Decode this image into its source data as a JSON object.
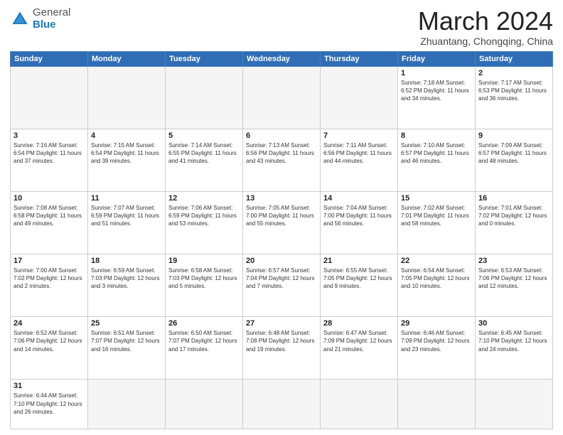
{
  "header": {
    "logo_general": "General",
    "logo_blue": "Blue",
    "month_title": "March 2024",
    "subtitle": "Zhuantang, Chongqing, China"
  },
  "weekdays": [
    "Sunday",
    "Monday",
    "Tuesday",
    "Wednesday",
    "Thursday",
    "Friday",
    "Saturday"
  ],
  "weeks": [
    [
      {
        "day": "",
        "info": ""
      },
      {
        "day": "",
        "info": ""
      },
      {
        "day": "",
        "info": ""
      },
      {
        "day": "",
        "info": ""
      },
      {
        "day": "",
        "info": ""
      },
      {
        "day": "1",
        "info": "Sunrise: 7:18 AM\nSunset: 6:52 PM\nDaylight: 11 hours\nand 34 minutes."
      },
      {
        "day": "2",
        "info": "Sunrise: 7:17 AM\nSunset: 6:53 PM\nDaylight: 11 hours\nand 36 minutes."
      }
    ],
    [
      {
        "day": "3",
        "info": "Sunrise: 7:16 AM\nSunset: 6:54 PM\nDaylight: 11 hours\nand 37 minutes."
      },
      {
        "day": "4",
        "info": "Sunrise: 7:15 AM\nSunset: 6:54 PM\nDaylight: 11 hours\nand 39 minutes."
      },
      {
        "day": "5",
        "info": "Sunrise: 7:14 AM\nSunset: 6:55 PM\nDaylight: 11 hours\nand 41 minutes."
      },
      {
        "day": "6",
        "info": "Sunrise: 7:13 AM\nSunset: 6:56 PM\nDaylight: 11 hours\nand 43 minutes."
      },
      {
        "day": "7",
        "info": "Sunrise: 7:11 AM\nSunset: 6:56 PM\nDaylight: 11 hours\nand 44 minutes."
      },
      {
        "day": "8",
        "info": "Sunrise: 7:10 AM\nSunset: 6:57 PM\nDaylight: 11 hours\nand 46 minutes."
      },
      {
        "day": "9",
        "info": "Sunrise: 7:09 AM\nSunset: 6:57 PM\nDaylight: 11 hours\nand 48 minutes."
      }
    ],
    [
      {
        "day": "10",
        "info": "Sunrise: 7:08 AM\nSunset: 6:58 PM\nDaylight: 11 hours\nand 49 minutes."
      },
      {
        "day": "11",
        "info": "Sunrise: 7:07 AM\nSunset: 6:59 PM\nDaylight: 11 hours\nand 51 minutes."
      },
      {
        "day": "12",
        "info": "Sunrise: 7:06 AM\nSunset: 6:59 PM\nDaylight: 11 hours\nand 53 minutes."
      },
      {
        "day": "13",
        "info": "Sunrise: 7:05 AM\nSunset: 7:00 PM\nDaylight: 11 hours\nand 55 minutes."
      },
      {
        "day": "14",
        "info": "Sunrise: 7:04 AM\nSunset: 7:00 PM\nDaylight: 11 hours\nand 56 minutes."
      },
      {
        "day": "15",
        "info": "Sunrise: 7:02 AM\nSunset: 7:01 PM\nDaylight: 11 hours\nand 58 minutes."
      },
      {
        "day": "16",
        "info": "Sunrise: 7:01 AM\nSunset: 7:02 PM\nDaylight: 12 hours\nand 0 minutes."
      }
    ],
    [
      {
        "day": "17",
        "info": "Sunrise: 7:00 AM\nSunset: 7:02 PM\nDaylight: 12 hours\nand 2 minutes."
      },
      {
        "day": "18",
        "info": "Sunrise: 6:59 AM\nSunset: 7:03 PM\nDaylight: 12 hours\nand 3 minutes."
      },
      {
        "day": "19",
        "info": "Sunrise: 6:58 AM\nSunset: 7:03 PM\nDaylight: 12 hours\nand 5 minutes."
      },
      {
        "day": "20",
        "info": "Sunrise: 6:57 AM\nSunset: 7:04 PM\nDaylight: 12 hours\nand 7 minutes."
      },
      {
        "day": "21",
        "info": "Sunrise: 6:55 AM\nSunset: 7:05 PM\nDaylight: 12 hours\nand 9 minutes."
      },
      {
        "day": "22",
        "info": "Sunrise: 6:54 AM\nSunset: 7:05 PM\nDaylight: 12 hours\nand 10 minutes."
      },
      {
        "day": "23",
        "info": "Sunrise: 6:53 AM\nSunset: 7:06 PM\nDaylight: 12 hours\nand 12 minutes."
      }
    ],
    [
      {
        "day": "24",
        "info": "Sunrise: 6:52 AM\nSunset: 7:06 PM\nDaylight: 12 hours\nand 14 minutes."
      },
      {
        "day": "25",
        "info": "Sunrise: 6:51 AM\nSunset: 7:07 PM\nDaylight: 12 hours\nand 16 minutes."
      },
      {
        "day": "26",
        "info": "Sunrise: 6:50 AM\nSunset: 7:07 PM\nDaylight: 12 hours\nand 17 minutes."
      },
      {
        "day": "27",
        "info": "Sunrise: 6:48 AM\nSunset: 7:08 PM\nDaylight: 12 hours\nand 19 minutes."
      },
      {
        "day": "28",
        "info": "Sunrise: 6:47 AM\nSunset: 7:09 PM\nDaylight: 12 hours\nand 21 minutes."
      },
      {
        "day": "29",
        "info": "Sunrise: 6:46 AM\nSunset: 7:09 PM\nDaylight: 12 hours\nand 23 minutes."
      },
      {
        "day": "30",
        "info": "Sunrise: 6:45 AM\nSunset: 7:10 PM\nDaylight: 12 hours\nand 24 minutes."
      }
    ],
    [
      {
        "day": "31",
        "info": "Sunrise: 6:44 AM\nSunset: 7:10 PM\nDaylight: 12 hours\nand 26 minutes."
      },
      {
        "day": "",
        "info": ""
      },
      {
        "day": "",
        "info": ""
      },
      {
        "day": "",
        "info": ""
      },
      {
        "day": "",
        "info": ""
      },
      {
        "day": "",
        "info": ""
      },
      {
        "day": "",
        "info": ""
      }
    ]
  ]
}
